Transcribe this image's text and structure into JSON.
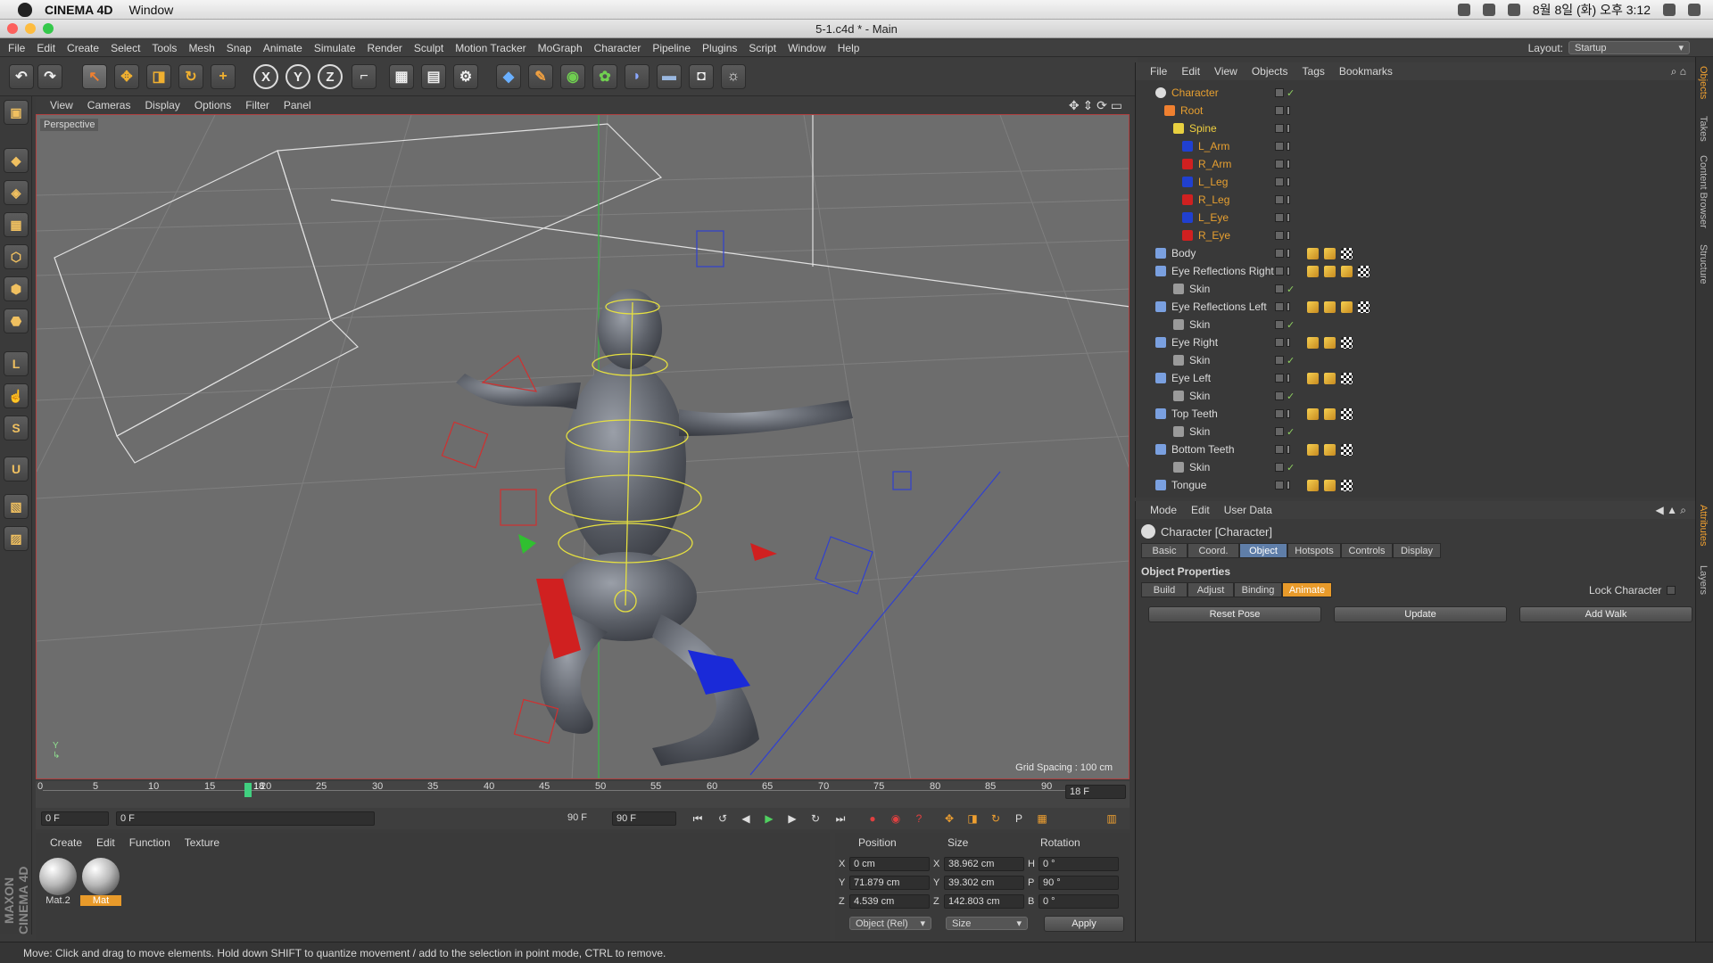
{
  "macmenu": {
    "app": "CINEMA 4D",
    "window": "Window",
    "datetime": "8월 8일 (화) 오후 3:12"
  },
  "title": "5-1.c4d * - Main",
  "appmenu": [
    "File",
    "Edit",
    "Create",
    "Select",
    "Tools",
    "Mesh",
    "Snap",
    "Animate",
    "Simulate",
    "Render",
    "Sculpt",
    "Motion Tracker",
    "MoGraph",
    "Character",
    "Pipeline",
    "Plugins",
    "Script",
    "Window",
    "Help"
  ],
  "layout": {
    "label": "Layout:",
    "value": "Startup"
  },
  "toolbar": {
    "x": "X",
    "y": "Y",
    "z": "Z"
  },
  "viewport": {
    "menu": [
      "View",
      "Cameras",
      "Display",
      "Options",
      "Filter",
      "Panel"
    ],
    "label": "Perspective",
    "grid_spacing": "Grid Spacing : 100 cm"
  },
  "timeline": {
    "ticks": [
      "0",
      "5",
      "10",
      "15",
      "20",
      "25",
      "30",
      "35",
      "40",
      "45",
      "50",
      "55",
      "60",
      "65",
      "70",
      "75",
      "80",
      "85",
      "90"
    ],
    "current_marker": "18",
    "current_frame": "18 F",
    "start": "0 F",
    "range_start": "0 F",
    "range_end": "90 F",
    "end": "90 F"
  },
  "material": {
    "menu": [
      "Create",
      "Edit",
      "Function",
      "Texture"
    ],
    "items": [
      {
        "name": "Mat.2"
      },
      {
        "name": "Mat"
      }
    ]
  },
  "coords": {
    "headers": [
      "Position",
      "Size",
      "Rotation"
    ],
    "rows": [
      {
        "axis": "X",
        "pos": "0 cm",
        "size_axis": "X",
        "size": "38.962 cm",
        "rot_axis": "H",
        "rot": "0 °"
      },
      {
        "axis": "Y",
        "pos": "71.879 cm",
        "size_axis": "Y",
        "size": "39.302 cm",
        "rot_axis": "P",
        "rot": "90 °"
      },
      {
        "axis": "Z",
        "pos": "4.539 cm",
        "size_axis": "Z",
        "size": "142.803 cm",
        "rot_axis": "B",
        "rot": "0 °"
      }
    ],
    "mode": "Object (Rel)",
    "size_mode": "Size",
    "apply": "Apply"
  },
  "maxon": "MAXON CINEMA 4D",
  "status": "Move: Click and drag to move elements. Hold down SHIFT to quantize movement / add to the selection in point mode, CTRL to remove.",
  "objects": {
    "menu": [
      "File",
      "Edit",
      "View",
      "Objects",
      "Tags",
      "Bookmarks"
    ],
    "rows": [
      {
        "name": "Character",
        "color": "#e8a030"
      },
      {
        "name": "Root",
        "color": "#e8a030"
      },
      {
        "name": "Spine",
        "color": "#f0d040"
      },
      {
        "name": "L_Arm",
        "color": "#e8a030"
      },
      {
        "name": "R_Arm",
        "color": "#e8a030"
      },
      {
        "name": "L_Leg",
        "color": "#e8a030"
      },
      {
        "name": "R_Leg",
        "color": "#e8a030"
      },
      {
        "name": "L_Eye",
        "color": "#e8a030"
      },
      {
        "name": "R_Eye",
        "color": "#e8a030"
      },
      {
        "name": "Body",
        "color": "#dcdcdc"
      },
      {
        "name": "Eye Reflections Right",
        "color": "#dcdcdc"
      },
      {
        "name": "Skin",
        "color": "#dcdcdc"
      },
      {
        "name": "Eye Reflections Left",
        "color": "#dcdcdc"
      },
      {
        "name": "Skin",
        "color": "#dcdcdc"
      },
      {
        "name": "Eye Right",
        "color": "#dcdcdc"
      },
      {
        "name": "Skin",
        "color": "#dcdcdc"
      },
      {
        "name": "Eye Left",
        "color": "#dcdcdc"
      },
      {
        "name": "Skin",
        "color": "#dcdcdc"
      },
      {
        "name": "Top Teeth",
        "color": "#dcdcdc"
      },
      {
        "name": "Skin",
        "color": "#dcdcdc"
      },
      {
        "name": "Bottom Teeth",
        "color": "#dcdcdc"
      },
      {
        "name": "Skin",
        "color": "#dcdcdc"
      },
      {
        "name": "Tongue",
        "color": "#dcdcdc"
      }
    ]
  },
  "attributes": {
    "menu": [
      "Mode",
      "Edit",
      "User Data"
    ],
    "title": "Character [Character]",
    "tabs": [
      "Basic",
      "Coord.",
      "Object",
      "Hotspots",
      "Controls",
      "Display"
    ],
    "section": "Object Properties",
    "subtabs": [
      "Build",
      "Adjust",
      "Binding",
      "Animate"
    ],
    "lock": "Lock Character",
    "buttons": [
      "Reset Pose",
      "Update",
      "Add Walk"
    ]
  },
  "sidetabs": [
    "Objects",
    "Takes",
    "Content Browser",
    "Structure",
    "Attributes",
    "Layers"
  ]
}
